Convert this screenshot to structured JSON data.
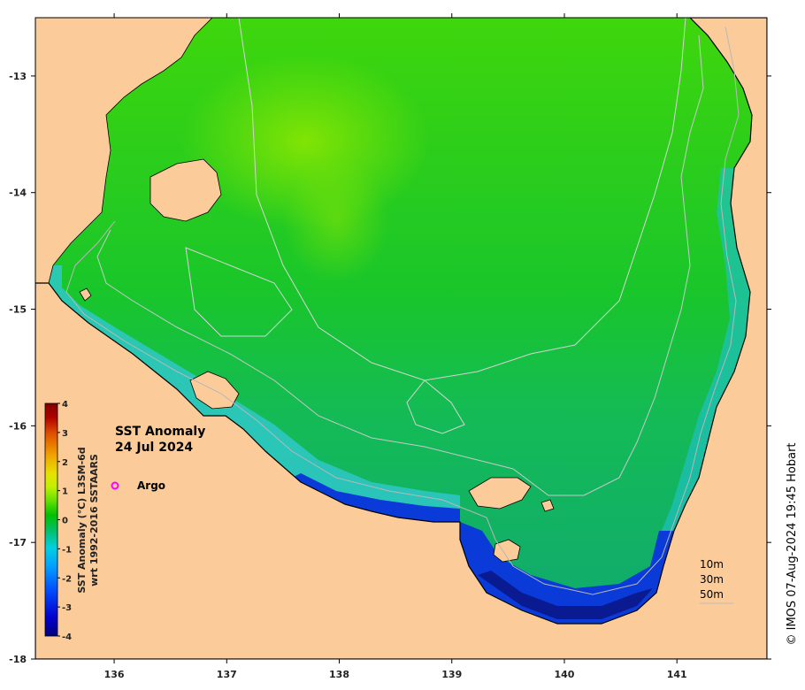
{
  "map": {
    "title_line1": "SST Anomaly",
    "title_line2": "24 Jul 2024",
    "x_ticks": [
      "136",
      "137",
      "138",
      "139",
      "140",
      "141"
    ],
    "y_ticks": [
      "-13",
      "-14",
      "-15",
      "-16",
      "-17",
      "-18"
    ],
    "legend": {
      "argo_label": "Argo",
      "argo_color": "#ff00ff"
    },
    "depth_contours": [
      "10m",
      "30m",
      "50m"
    ],
    "credit": "© IMOS 07-Aug-2024 19:45 Hobart",
    "land_color": "#fbcc99",
    "x_range": [
      135.3,
      141.8
    ],
    "y_range": [
      -18,
      -12.5
    ]
  },
  "colorbar": {
    "title_line1": "SST Anomaly (°C) L3SM-6d",
    "title_line2": "wrt 1992-2016 SSTAARS",
    "ticks": [
      "4",
      "3",
      "2",
      "1",
      "0",
      "-1",
      "-2",
      "-3",
      "-4"
    ],
    "range": [
      -4,
      4
    ],
    "colors": [
      "#000080",
      "#0000cd",
      "#0050ff",
      "#00a0ff",
      "#00d0e0",
      "#00c070",
      "#00c000",
      "#60e000",
      "#c0f000",
      "#e8e000",
      "#f0a000",
      "#e05000",
      "#b00000",
      "#800000"
    ]
  }
}
